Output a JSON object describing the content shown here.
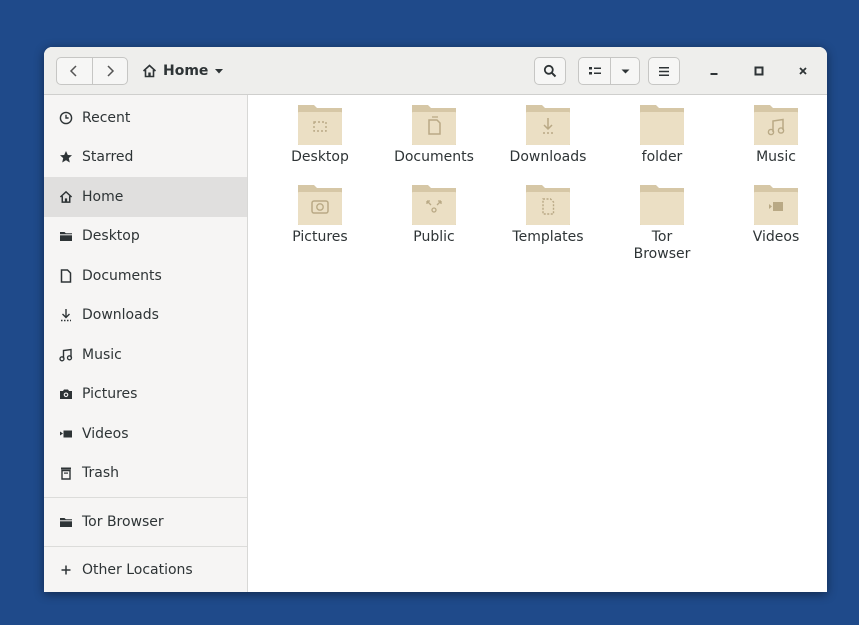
{
  "header": {
    "location": "Home",
    "icons": {
      "back": "chevron-left-icon",
      "forward": "chevron-right-icon",
      "home": "home-icon",
      "dropdown": "chevron-down-icon",
      "search": "search-icon",
      "view": "list-view-icon",
      "menu": "hamburger-icon",
      "minimize": "minimize-icon",
      "maximize": "maximize-icon",
      "close": "close-icon"
    }
  },
  "sidebar": {
    "items": [
      {
        "label": "Recent",
        "icon": "clock-icon"
      },
      {
        "label": "Starred",
        "icon": "star-icon"
      },
      {
        "label": "Home",
        "icon": "home-icon",
        "active": true
      },
      {
        "label": "Desktop",
        "icon": "folder-icon"
      },
      {
        "label": "Documents",
        "icon": "document-icon"
      },
      {
        "label": "Downloads",
        "icon": "download-icon"
      },
      {
        "label": "Music",
        "icon": "music-icon"
      },
      {
        "label": "Pictures",
        "icon": "camera-icon"
      },
      {
        "label": "Videos",
        "icon": "video-icon"
      },
      {
        "label": "Trash",
        "icon": "trash-icon"
      }
    ],
    "bookmarks": [
      {
        "label": "Tor Browser",
        "icon": "folder-icon"
      }
    ],
    "other": {
      "label": "Other Locations",
      "icon": "plus-icon"
    }
  },
  "files": [
    {
      "label": "Desktop",
      "icon": "desktop-folder-icon"
    },
    {
      "label": "Documents",
      "icon": "documents-folder-icon"
    },
    {
      "label": "Downloads",
      "icon": "downloads-folder-icon"
    },
    {
      "label": "folder",
      "icon": "folder-icon"
    },
    {
      "label": "Music",
      "icon": "music-folder-icon"
    },
    {
      "label": "Pictures",
      "icon": "pictures-folder-icon"
    },
    {
      "label": "Public",
      "icon": "public-folder-icon"
    },
    {
      "label": "Templates",
      "icon": "templates-folder-icon"
    },
    {
      "label": "Tor Browser",
      "icon": "folder-icon"
    },
    {
      "label": "Videos",
      "icon": "videos-folder-icon"
    }
  ],
  "colors": {
    "desktop_bg": "#1f4a8a",
    "folder_back": "#d6c7a6",
    "folder_front": "#ebdfc4",
    "folder_emblem": "#b9a985"
  }
}
